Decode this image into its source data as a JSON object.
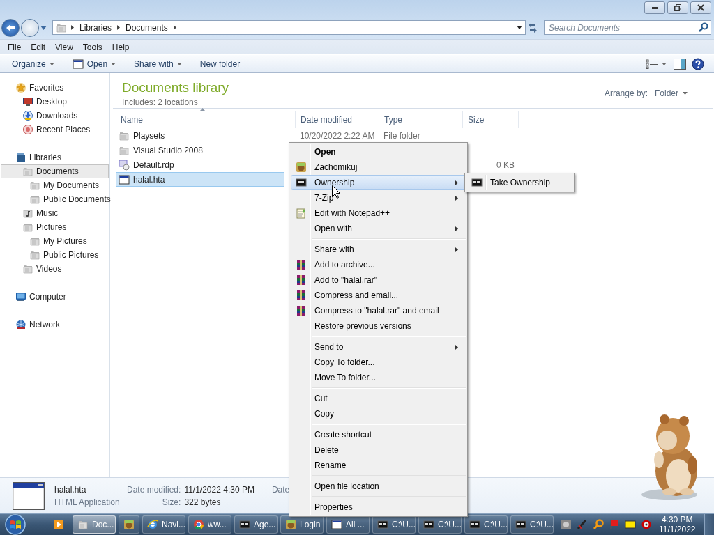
{
  "address": {
    "breadcrumbs": [
      "Libraries",
      "Documents"
    ]
  },
  "search": {
    "placeholder": "Search Documents"
  },
  "menu_bar": [
    "File",
    "Edit",
    "View",
    "Tools",
    "Help"
  ],
  "toolbar": [
    {
      "label": "Organize",
      "dropdown": true
    },
    {
      "label": "Open",
      "dropdown": true
    },
    {
      "label": "Share with",
      "dropdown": true
    },
    {
      "label": "New folder",
      "dropdown": false
    }
  ],
  "nav_pane": [
    {
      "label": "Favorites",
      "selected": false,
      "children": [
        {
          "label": "Desktop",
          "selected": false
        },
        {
          "label": "Downloads",
          "selected": false
        },
        {
          "label": "Recent Places",
          "selected": false
        }
      ]
    },
    {
      "label": "Libraries",
      "selected": false,
      "children": [
        {
          "label": "Documents",
          "selected": true,
          "children": [
            {
              "label": "My Documents",
              "selected": false
            },
            {
              "label": "Public Documents",
              "selected": false
            }
          ]
        },
        {
          "label": "Music",
          "selected": false
        },
        {
          "label": "Pictures",
          "selected": false,
          "children": [
            {
              "label": "My Pictures",
              "selected": false
            },
            {
              "label": "Public Pictures",
              "selected": false
            }
          ]
        },
        {
          "label": "Videos",
          "selected": false
        }
      ]
    },
    {
      "label": "Computer",
      "selected": false
    },
    {
      "label": "Network",
      "selected": false
    }
  ],
  "library": {
    "title": "Documents library",
    "subtitle": "Includes:  2 locations",
    "arrange_label": "Arrange by:",
    "arrange_value": "Folder"
  },
  "file_list": {
    "columns": [
      "Name",
      "Date modified",
      "Type",
      "Size"
    ],
    "rows": [
      {
        "name": "Playsets",
        "date": "10/20/2022 2:22 AM",
        "type": "File folder",
        "selected": false
      },
      {
        "name": "Visual Studio 2008",
        "selected": false
      },
      {
        "name": "Default.rdp",
        "size": "0 KB",
        "selected": false
      },
      {
        "name": "halal.hta",
        "selected": true
      }
    ]
  },
  "details": {
    "name": "halal.hta",
    "type": "HTML Application",
    "fields": [
      {
        "label": "Date modified:",
        "value": "11/1/2022 4:30 PM"
      },
      {
        "label": "Size:",
        "value": "322 bytes"
      },
      {
        "label": "Date"
      }
    ]
  },
  "context_menu": [
    {
      "kind": "item",
      "label": "Open",
      "bold": true,
      "submenu": false,
      "selected": false
    },
    {
      "kind": "item",
      "label": "Zachomikuj",
      "bold": false,
      "submenu": false,
      "selected": false
    },
    {
      "kind": "item",
      "label": "Ownership",
      "bold": false,
      "submenu": true,
      "selected": true
    },
    {
      "kind": "item",
      "label": "7-Zip",
      "bold": false,
      "submenu": true,
      "selected": false
    },
    {
      "kind": "item",
      "label": "Edit with Notepad++",
      "bold": false,
      "submenu": false,
      "selected": false
    },
    {
      "kind": "item",
      "label": "Open with",
      "bold": false,
      "submenu": true,
      "selected": false
    },
    {
      "kind": "separator"
    },
    {
      "kind": "item",
      "label": "Share with",
      "bold": false,
      "submenu": true,
      "selected": false
    },
    {
      "kind": "item",
      "label": "Add to archive...",
      "bold": false,
      "submenu": false,
      "selected": false
    },
    {
      "kind": "item",
      "label": "Add to \"halal.rar\"",
      "bold": false,
      "submenu": false,
      "selected": false
    },
    {
      "kind": "item",
      "label": "Compress and email...",
      "bold": false,
      "submenu": false,
      "selected": false
    },
    {
      "kind": "item",
      "label": "Compress to \"halal.rar\" and email",
      "bold": false,
      "submenu": false,
      "selected": false
    },
    {
      "kind": "item",
      "label": "Restore previous versions",
      "bold": false,
      "submenu": false,
      "selected": false
    },
    {
      "kind": "separator"
    },
    {
      "kind": "item",
      "label": "Send to",
      "bold": false,
      "submenu": true,
      "selected": false
    },
    {
      "kind": "item",
      "label": "Copy To folder...",
      "bold": false,
      "submenu": false,
      "selected": false
    },
    {
      "kind": "item",
      "label": "Move To folder...",
      "bold": false,
      "submenu": false,
      "selected": false
    },
    {
      "kind": "separator"
    },
    {
      "kind": "item",
      "label": "Cut",
      "bold": false,
      "submenu": false,
      "selected": false
    },
    {
      "kind": "item",
      "label": "Copy",
      "bold": false,
      "submenu": false,
      "selected": false
    },
    {
      "kind": "separator"
    },
    {
      "kind": "item",
      "label": "Create shortcut",
      "bold": false,
      "submenu": false,
      "selected": false
    },
    {
      "kind": "item",
      "label": "Delete",
      "bold": false,
      "submenu": false,
      "selected": false
    },
    {
      "kind": "item",
      "label": "Rename",
      "bold": false,
      "submenu": false,
      "selected": false
    },
    {
      "kind": "separator"
    },
    {
      "kind": "item",
      "label": "Open file location",
      "bold": false,
      "submenu": false,
      "selected": false
    },
    {
      "kind": "separator"
    },
    {
      "kind": "item",
      "label": "Properties",
      "bold": false,
      "submenu": false,
      "selected": false
    }
  ],
  "submenu": [
    {
      "label": "Take Ownership",
      "selected": false
    }
  ],
  "taskbar": {
    "buttons": [
      {
        "selected": false
      },
      {
        "label": "Doc...",
        "selected": true
      },
      {
        "selected": false
      },
      {
        "label": "Navi...",
        "selected": false
      },
      {
        "label": "ww...",
        "selected": false
      },
      {
        "label": "Age...",
        "selected": false
      },
      {
        "label": "Login",
        "selected": false
      },
      {
        "label": "All ...",
        "selected": false
      },
      {
        "label": "C:\\U...",
        "selected": false
      },
      {
        "label": "C:\\U...",
        "selected": false
      },
      {
        "label": "C:\\U...",
        "selected": false
      },
      {
        "label": "C:\\U...",
        "selected": false
      }
    ],
    "clock": {
      "time": "4:30 PM",
      "date": "11/1/2022"
    }
  }
}
